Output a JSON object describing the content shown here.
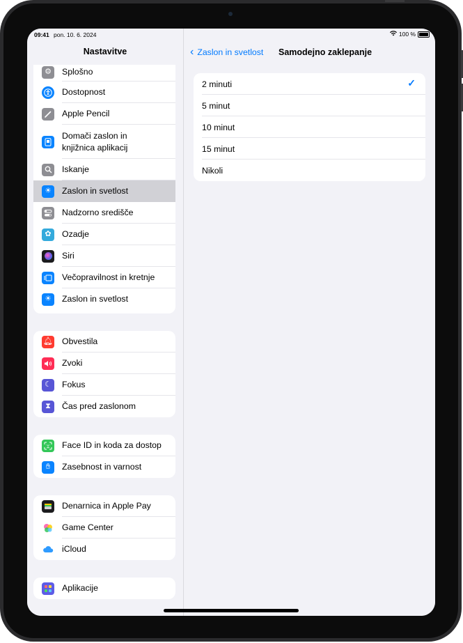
{
  "status": {
    "time": "09:41",
    "date": "pon. 10. 6. 2024",
    "battery": "100 %"
  },
  "sidebar": {
    "title": "Nastavitve",
    "group1": [
      {
        "label": "Splošno",
        "icon": "gear-icon",
        "color": "#8e8e93"
      },
      {
        "label": "Dostopnost",
        "icon": "accessibility-icon",
        "color": "#0a84ff"
      },
      {
        "label": "Apple Pencil",
        "icon": "pencil-icon",
        "color": "#8e8e93"
      },
      {
        "label": "Domači zaslon in knjižnica aplikacij",
        "icon": "home-screen-icon",
        "color": "#0a84ff"
      },
      {
        "label": "Iskanje",
        "icon": "search-icon",
        "color": "#8e8e93"
      },
      {
        "label": "Zaslon in svetlost",
        "icon": "brightness-icon",
        "color": "#0a84ff",
        "selected": true
      },
      {
        "label": "Nadzorno središče",
        "icon": "toggles-icon",
        "color": "#8e8e93"
      },
      {
        "label": "Ozadje",
        "icon": "flower-icon",
        "color": "#34aadc"
      },
      {
        "label": "Siri",
        "icon": "siri-icon",
        "color": "#3a3a3c"
      },
      {
        "label": "Večopravilnost in kretnje",
        "icon": "multitasking-icon",
        "color": "#0a84ff"
      },
      {
        "label": "Zaslon in svetlost",
        "icon": "brightness-icon",
        "color": "#0a84ff"
      }
    ],
    "group2": [
      {
        "label": "Obvestila",
        "icon": "bell-icon",
        "color": "#ff3b30"
      },
      {
        "label": "Zvoki",
        "icon": "speaker-icon",
        "color": "#ff2d55"
      },
      {
        "label": "Fokus",
        "icon": "moon-icon",
        "color": "#5856d6"
      },
      {
        "label": "Čas pred zaslonom",
        "icon": "hourglass-icon",
        "color": "#5856d6"
      }
    ],
    "group3": [
      {
        "label": "Face ID in koda za dostop",
        "icon": "faceid-icon",
        "color": "#34c759"
      },
      {
        "label": "Zasebnost in varnost",
        "icon": "hand-icon",
        "color": "#0a84ff"
      }
    ],
    "group4": [
      {
        "label": "Denarnica in Apple Pay",
        "icon": "wallet-icon",
        "color": "#1c1c1e"
      },
      {
        "label": "Game Center",
        "icon": "game-center-icon",
        "color": "#ffffff"
      },
      {
        "label": "iCloud",
        "icon": "cloud-icon",
        "color": "#ffffff"
      }
    ],
    "group5": [
      {
        "label": "Aplikacije",
        "icon": "apps-grid-icon",
        "color": "#5e5ce6"
      }
    ]
  },
  "detail": {
    "back_label": "Zaslon in svetlost",
    "title": "Samodejno zaklepanje",
    "options": [
      {
        "label": "2 minuti",
        "checked": true
      },
      {
        "label": "5 minut",
        "checked": false
      },
      {
        "label": "10 minut",
        "checked": false
      },
      {
        "label": "15 minut",
        "checked": false
      },
      {
        "label": "Nikoli",
        "checked": false
      }
    ]
  },
  "colors": {
    "accent": "#007aff",
    "selected_row": "#d1d1d6",
    "background": "#f2f2f7"
  }
}
